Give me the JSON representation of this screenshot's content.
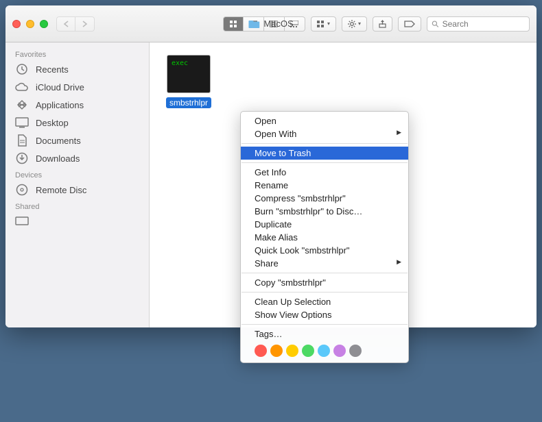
{
  "window": {
    "title": "MacOS"
  },
  "toolbar": {
    "search_placeholder": "Search"
  },
  "sidebar": {
    "sections": [
      {
        "header": "Favorites",
        "items": [
          {
            "label": "Recents",
            "icon": "clock"
          },
          {
            "label": "iCloud Drive",
            "icon": "cloud"
          },
          {
            "label": "Applications",
            "icon": "app"
          },
          {
            "label": "Desktop",
            "icon": "desktop"
          },
          {
            "label": "Documents",
            "icon": "doc"
          },
          {
            "label": "Downloads",
            "icon": "download"
          }
        ]
      },
      {
        "header": "Devices",
        "items": [
          {
            "label": "Remote Disc",
            "icon": "disc"
          }
        ]
      },
      {
        "header": "Shared",
        "items": [
          {
            "label": "",
            "icon": "screen"
          }
        ]
      }
    ]
  },
  "file": {
    "name": "smbstrhlpr",
    "exec_label": "exec"
  },
  "context_menu": {
    "groups": [
      [
        {
          "label": "Open",
          "submenu": false,
          "highlighted": false
        },
        {
          "label": "Open With",
          "submenu": true,
          "highlighted": false
        }
      ],
      [
        {
          "label": "Move to Trash",
          "submenu": false,
          "highlighted": true
        }
      ],
      [
        {
          "label": "Get Info",
          "submenu": false,
          "highlighted": false
        },
        {
          "label": "Rename",
          "submenu": false,
          "highlighted": false
        },
        {
          "label": "Compress \"smbstrhlpr\"",
          "submenu": false,
          "highlighted": false
        },
        {
          "label": "Burn \"smbstrhlpr\" to Disc…",
          "submenu": false,
          "highlighted": false
        },
        {
          "label": "Duplicate",
          "submenu": false,
          "highlighted": false
        },
        {
          "label": "Make Alias",
          "submenu": false,
          "highlighted": false
        },
        {
          "label": "Quick Look \"smbstrhlpr\"",
          "submenu": false,
          "highlighted": false
        },
        {
          "label": "Share",
          "submenu": true,
          "highlighted": false
        }
      ],
      [
        {
          "label": "Copy \"smbstrhlpr\"",
          "submenu": false,
          "highlighted": false
        }
      ],
      [
        {
          "label": "Clean Up Selection",
          "submenu": false,
          "highlighted": false
        },
        {
          "label": "Show View Options",
          "submenu": false,
          "highlighted": false
        }
      ],
      [
        {
          "label": "Tags…",
          "submenu": false,
          "highlighted": false
        }
      ]
    ],
    "tag_colors": [
      "#ff5a52",
      "#ff9500",
      "#ffcc00",
      "#4cd964",
      "#5ac8fa",
      "#c781e4",
      "#8e8e93"
    ]
  }
}
